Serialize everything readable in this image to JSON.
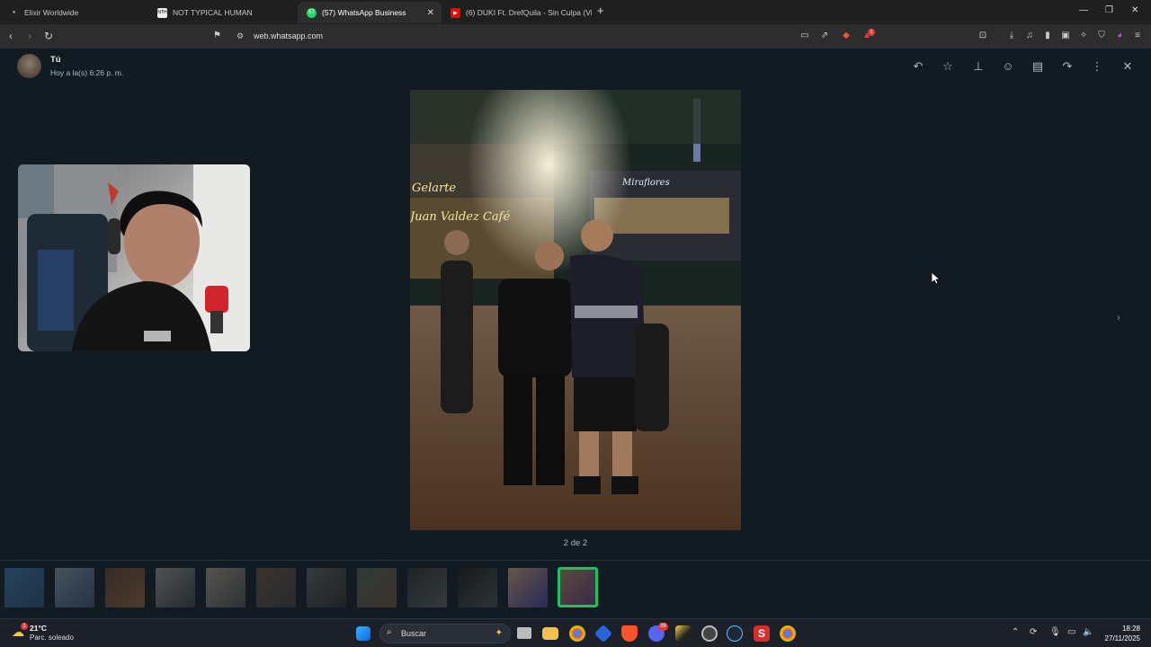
{
  "browser": {
    "tabs": [
      {
        "label": "Elixir Worldwide"
      },
      {
        "label": "NOT TYPICAL HUMAN"
      },
      {
        "label": "(57) WhatsApp Business",
        "badge": "57"
      },
      {
        "label": "(6) DUKI Ft. DrefQuila - Sin Culpa (Vi"
      }
    ],
    "new_tab": "+",
    "url": "web.whatsapp.com",
    "alert_badge": "1"
  },
  "viewer": {
    "sender": "Tú",
    "time": "Hoy a la(s) 6:26 p. m.",
    "counter": "2 de 2",
    "photo_signs": {
      "sign1": "Gelarte",
      "sign2": "Juan Valdez Café",
      "sign3": "Miraflores"
    },
    "actions": [
      "reply-icon",
      "star-icon",
      "pin-icon",
      "emoji-icon",
      "delete-icon",
      "forward-icon",
      "more-icon",
      "close-icon"
    ]
  },
  "taskbar": {
    "weather_temp": "21°C",
    "weather_desc": "Parc. soleado",
    "weather_badge": "1",
    "search_label": "Buscar",
    "time": "18:28",
    "date": "27/11/2025",
    "discord_badge": "39"
  },
  "colors": {
    "accent": "#21c063",
    "background": "#111b21",
    "taskbar": "#1c2028"
  }
}
